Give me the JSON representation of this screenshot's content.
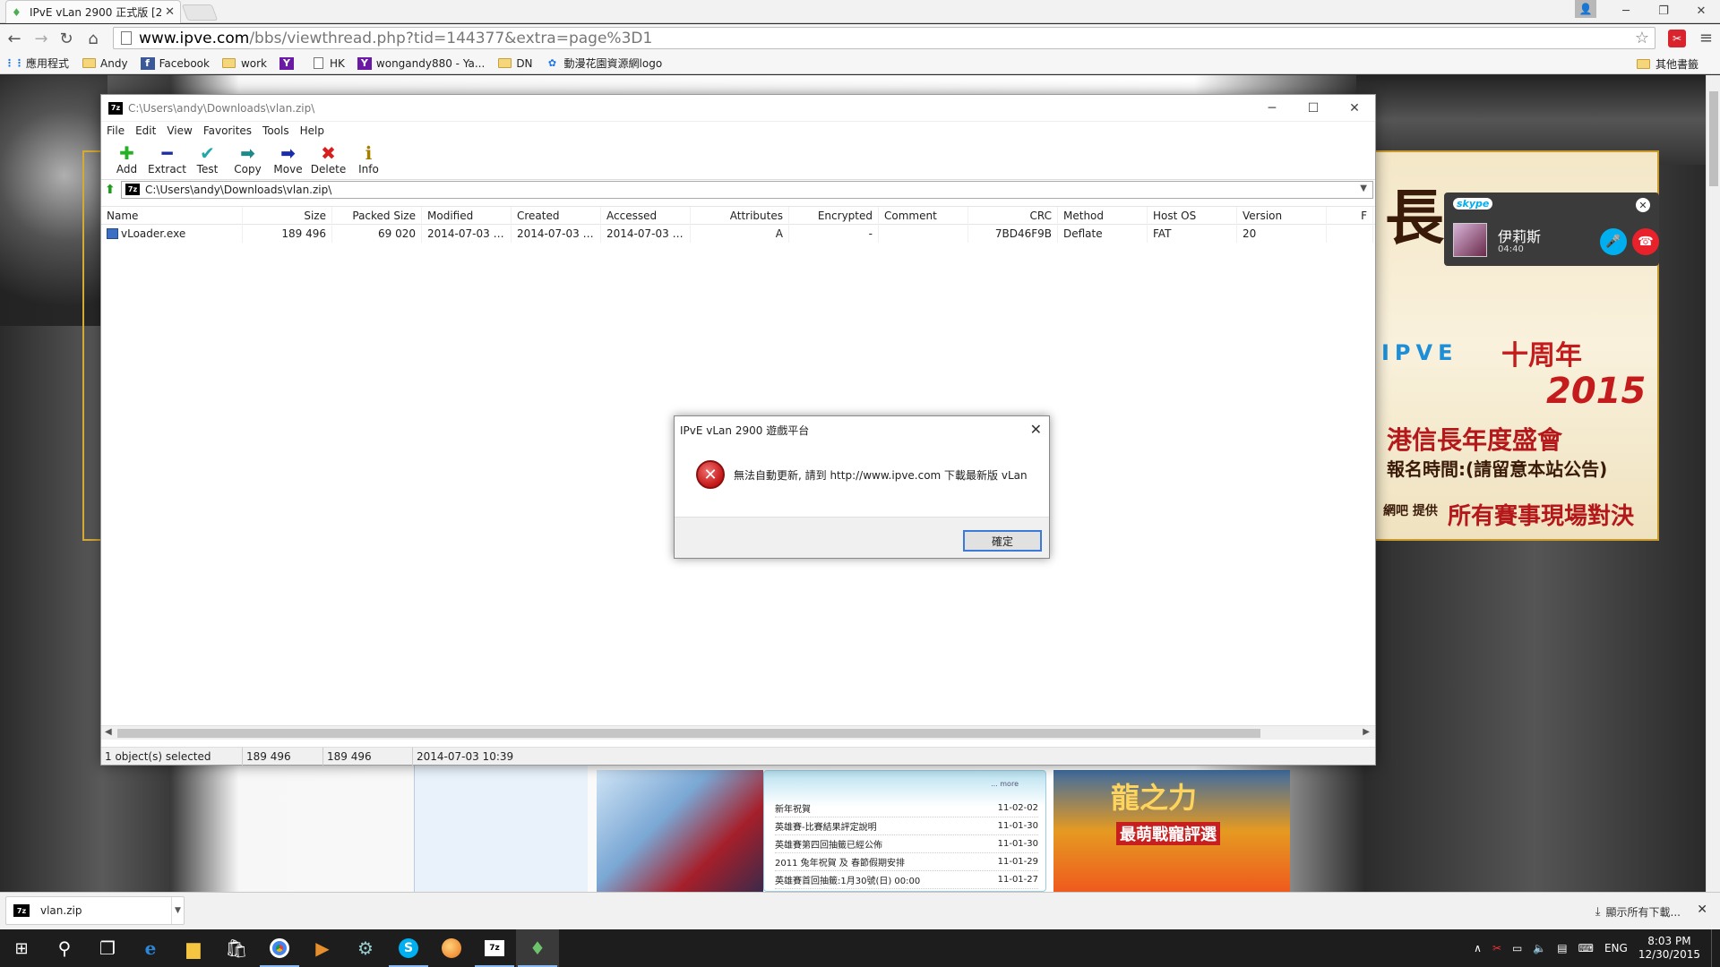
{
  "browser": {
    "tab_title": "IPvE vLan 2900 正式版 [2(",
    "tab_close": "✕",
    "url_host": "www.ipve.com",
    "url_path": "/bbs/viewthread.php?tid=144377&extra=page%3D1",
    "bookmarks": [
      {
        "label": "應用程式",
        "icon": "apps-grid-icon"
      },
      {
        "label": "Andy",
        "icon": "folder-icon"
      },
      {
        "label": "Facebook",
        "icon": "facebook-icon"
      },
      {
        "label": "work",
        "icon": "folder-icon"
      },
      {
        "label": "",
        "icon": "yahoo-icon"
      },
      {
        "label": "HK",
        "icon": "page-icon"
      },
      {
        "label": "wongandy880 - Ya...",
        "icon": "yahoo-icon"
      },
      {
        "label": "DN",
        "icon": "folder-icon"
      },
      {
        "label": "動漫花園資源網logo",
        "icon": "site-icon"
      }
    ],
    "other_bookmarks": "其他書籤"
  },
  "site": {
    "banner": {
      "line1": "長",
      "line2": "IPVE",
      "line3": "十周年",
      "line4": "2015",
      "line5": "港信長年度盛會",
      "line6": "報名時間:(請留意本站公告)",
      "line7": "網吧 提供",
      "line8": "所有賽事現場對決"
    },
    "news": [
      {
        "title": "新年祝賀",
        "date": "11-02-02"
      },
      {
        "title": "英雄賽-比賽結果評定說明",
        "date": "11-01-30"
      },
      {
        "title": "英雄賽第四回抽籤已經公佈",
        "date": "11-01-30"
      },
      {
        "title": "2011 兔年祝賀 及 春節假期安排",
        "date": "11-01-29"
      },
      {
        "title": "英雄賽首回抽籤:1月30號(日) 00:00",
        "date": "11-01-27"
      }
    ],
    "news_more": "... more",
    "game_title": "龍之力",
    "game_sub": "最萌戰寵評選"
  },
  "skype": {
    "logo": "skype",
    "caller": "伊莉斯",
    "duration": "04:40"
  },
  "zip": {
    "title": "C:\\Users\\andy\\Downloads\\vlan.zip\\",
    "menu": [
      "File",
      "Edit",
      "View",
      "Favorites",
      "Tools",
      "Help"
    ],
    "tools": [
      {
        "label": "Add",
        "glyph": "✚",
        "cls": "ti-add",
        "name": "add-icon"
      },
      {
        "label": "Extract",
        "glyph": "━",
        "cls": "ti-extract",
        "name": "extract-icon"
      },
      {
        "label": "Test",
        "glyph": "✔",
        "cls": "ti-test",
        "name": "test-icon"
      },
      {
        "label": "Copy",
        "glyph": "➡",
        "cls": "ti-copy",
        "name": "copy-icon"
      },
      {
        "label": "Move",
        "glyph": "➡",
        "cls": "ti-move",
        "name": "move-icon"
      },
      {
        "label": "Delete",
        "glyph": "✖",
        "cls": "ti-delete",
        "name": "delete-icon"
      },
      {
        "label": "Info",
        "glyph": "ℹ",
        "cls": "ti-info",
        "name": "info-icon"
      }
    ],
    "address": "C:\\Users\\andy\\Downloads\\vlan.zip\\",
    "columns": [
      "Name",
      "Size",
      "Packed Size",
      "Modified",
      "Created",
      "Accessed",
      "Attributes",
      "Encrypted",
      "Comment",
      "CRC",
      "Method",
      "Host OS",
      "Version",
      "F"
    ],
    "rows": [
      [
        "vLoader.exe",
        "189 496",
        "69 020",
        "2014-07-03 1...",
        "2014-07-03 1...",
        "2014-07-03 0...",
        "A",
        "-",
        "",
        "7BD46F9B",
        "Deflate",
        "FAT",
        "20",
        ""
      ]
    ],
    "status": [
      "1 object(s) selected",
      "189 496",
      "189 496",
      "2014-07-03 10:39"
    ]
  },
  "dialog": {
    "title": "IPvE vLan 2900 遊戲平台",
    "message": "無法自動更新, 請到 http://www.ipve.com 下載最新版 vLan",
    "ok": "確定"
  },
  "download": {
    "file": "vlan.zip",
    "show_all": "顯示所有下載...",
    "close": "✕"
  },
  "taskbar": {
    "lang": "ENG",
    "time": "8:03 PM",
    "date": "12/30/2015"
  }
}
